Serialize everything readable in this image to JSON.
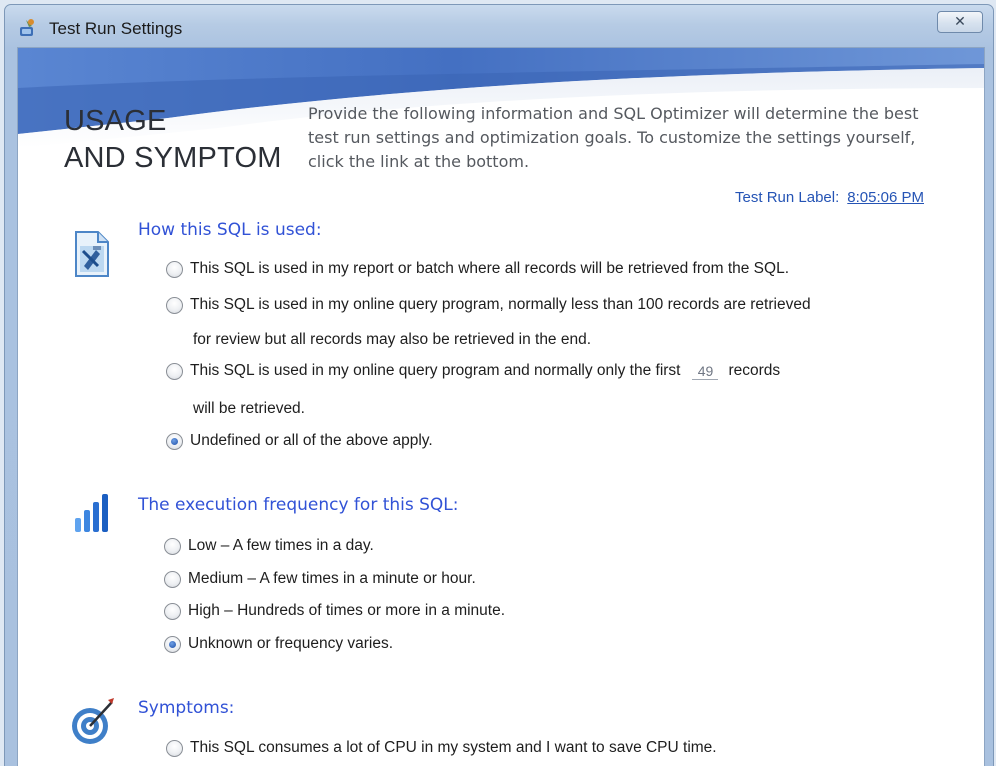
{
  "window": {
    "title": "Test Run Settings",
    "close_glyph": "✕"
  },
  "header": {
    "heading_line1": "USAGE",
    "heading_line2": "AND SYMPTOM",
    "intro": "Provide the following information and SQL Optimizer will determine the best test run settings and optimization goals. To customize the settings yourself, click the link at the bottom.",
    "run_label_caption": "Test Run Label:",
    "run_label_value": "8:05:06 PM"
  },
  "usage": {
    "title": "How this SQL is used:",
    "icon": "report-icon",
    "options": [
      {
        "text": "This SQL is used in my report or batch where all records will be retrieved from the SQL.",
        "checked": false
      },
      {
        "text": "This SQL is used in my online query program, normally less than 100 records are retrieved",
        "cont": "for review but all records may also be retrieved in the end.",
        "checked": false
      },
      {
        "text_before": "This SQL is used in my online query program and normally only the first",
        "records_value": "49",
        "text_after": "records",
        "cont": "will be retrieved.",
        "checked": false
      },
      {
        "text": "Undefined or all of the above apply.",
        "checked": true
      }
    ]
  },
  "frequency": {
    "title": "The execution frequency for this SQL:",
    "icon": "signal-bars-icon",
    "options": [
      {
        "text": "Low – A few times in a day.",
        "checked": false
      },
      {
        "text": "Medium – A few times in a minute or hour.",
        "checked": false
      },
      {
        "text": "High – Hundreds of times or more in a minute.",
        "checked": false
      },
      {
        "text": "Unknown or frequency varies.",
        "checked": true
      }
    ]
  },
  "symptoms": {
    "title": "Symptoms:",
    "icon": "target-icon",
    "options": [
      {
        "text": "This SQL consumes a lot of CPU in my system and I want to save CPU time.",
        "checked": false
      }
    ]
  },
  "colors": {
    "accent_blue": "#3152d6",
    "link_blue": "#2554b5",
    "header_band": "#4b78c8"
  }
}
